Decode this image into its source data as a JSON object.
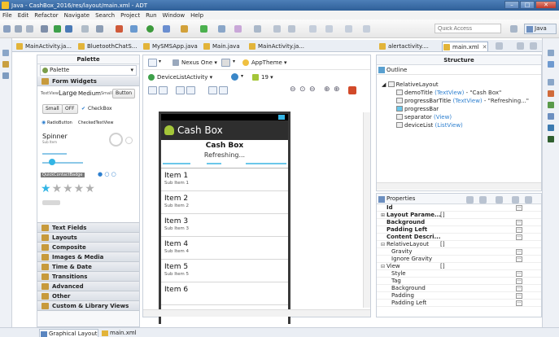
{
  "window": {
    "title": "Java - CashBox_2016/res/layout/main.xml - ADT"
  },
  "menu": [
    "File",
    "Edit",
    "Refactor",
    "Navigate",
    "Search",
    "Project",
    "Run",
    "Window",
    "Help"
  ],
  "toolbar": {
    "quick_access_placeholder": "Quick Access",
    "perspective": "Java"
  },
  "editor_tabs": [
    {
      "label": "MainActivity.ja...",
      "active": false
    },
    {
      "label": "BluetoothChatS...",
      "active": false
    },
    {
      "label": "MySMSApp.java",
      "active": false
    },
    {
      "label": "Main.java",
      "active": false
    },
    {
      "label": "MainActivity.ja...",
      "active": false
    },
    {
      "label": "alertactivity....",
      "active": false
    },
    {
      "label": "main.xml",
      "active": true
    }
  ],
  "palette": {
    "header": "Palette",
    "combo": "Palette",
    "form_widgets": "Form Widgets",
    "widgets": {
      "textview": "TextView",
      "large": "Large",
      "medium": "Medium",
      "small": "Small",
      "button": "Button",
      "small_btn": "Small",
      "off": "OFF",
      "checkbox": "CheckBox",
      "radio": "RadioButton",
      "checked_textview": "CheckedTextView",
      "spinner": "Spinner",
      "sub_item": "Sub Item",
      "quick_contact": "QuickContactBadge"
    },
    "categories": [
      "Text Fields",
      "Layouts",
      "Composite",
      "Images & Media",
      "Time & Date",
      "Transitions",
      "Advanced",
      "Other",
      "Custom & Library Views"
    ]
  },
  "canvas": {
    "device": "Nexus One",
    "theme": "AppTheme",
    "activity": "DeviceListActivity",
    "api": "19"
  },
  "device_screen": {
    "app_name": "Cash Box",
    "demo_title": "Cash Box",
    "progress_title": "Refreshing...",
    "items": [
      {
        "title": "Item 1",
        "sub": "Sub Item 1"
      },
      {
        "title": "Item 2",
        "sub": "Sub Item 2"
      },
      {
        "title": "Item 3",
        "sub": "Sub Item 3"
      },
      {
        "title": "Item 4",
        "sub": "Sub Item 4"
      },
      {
        "title": "Item 5",
        "sub": "Sub Item 5"
      },
      {
        "title": "Item 6",
        "sub": ""
      }
    ]
  },
  "outline": {
    "structure_header": "Structure",
    "tab": "Outline",
    "root": "RelativeLayout",
    "nodes": [
      {
        "id": "demoTitle",
        "type": "(TextView)",
        "value": "- \"Cash Box\""
      },
      {
        "id": "progressBarTitle",
        "type": "(TextView)",
        "value": "- \"Refreshing...\""
      },
      {
        "id": "progressBar",
        "type": "",
        "value": ""
      },
      {
        "id": "separator",
        "type": "(View)",
        "value": ""
      },
      {
        "id": "deviceList",
        "type": "(ListView)",
        "value": ""
      }
    ]
  },
  "properties": {
    "tab": "Properties",
    "rows": [
      {
        "key": "Id",
        "value": "",
        "bold": true,
        "indent": false,
        "expand": ""
      },
      {
        "key": "Layout Parame...",
        "value": "[]",
        "bold": true,
        "indent": false,
        "expand": "⊞"
      },
      {
        "key": "Background",
        "value": "",
        "bold": true,
        "indent": false,
        "expand": ""
      },
      {
        "key": "Padding Left",
        "value": "",
        "bold": true,
        "indent": false,
        "expand": ""
      },
      {
        "key": "Content Descri...",
        "value": "",
        "bold": true,
        "indent": false,
        "expand": ""
      },
      {
        "key": "RelativeLayout",
        "value": "[]",
        "bold": false,
        "indent": false,
        "expand": "⊟"
      },
      {
        "key": "Gravity",
        "value": "",
        "bold": false,
        "indent": true,
        "expand": ""
      },
      {
        "key": "Ignore Gravity",
        "value": "",
        "bold": false,
        "indent": true,
        "expand": ""
      },
      {
        "key": "View",
        "value": "[]",
        "bold": false,
        "indent": false,
        "expand": "⊟"
      },
      {
        "key": "Style",
        "value": "",
        "bold": false,
        "indent": true,
        "expand": ""
      },
      {
        "key": "Tag",
        "value": "",
        "bold": false,
        "indent": true,
        "expand": ""
      },
      {
        "key": "Background",
        "value": "",
        "bold": false,
        "indent": true,
        "expand": ""
      },
      {
        "key": "Padding",
        "value": "",
        "bold": false,
        "indent": true,
        "expand": ""
      },
      {
        "key": "Padding Left",
        "value": "",
        "bold": false,
        "indent": true,
        "expand": ""
      }
    ]
  },
  "bottom_tabs": [
    {
      "label": "Graphical Layout",
      "active": true
    },
    {
      "label": "main.xml",
      "active": false
    }
  ]
}
